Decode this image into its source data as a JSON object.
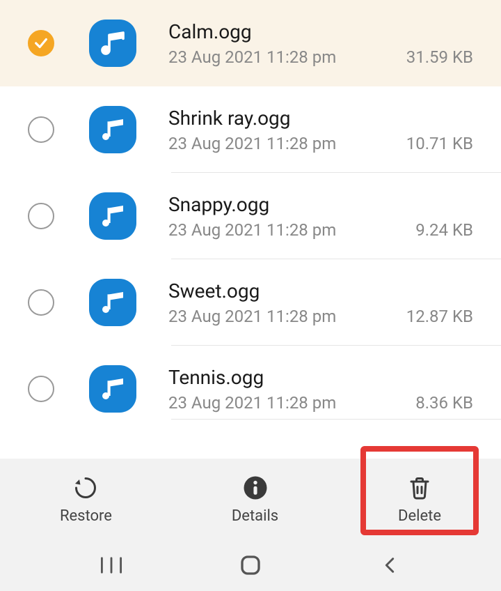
{
  "files": [
    {
      "name": "Calm.ogg",
      "date": "23 Aug 2021 11:28 pm",
      "size": "31.59 KB",
      "selected": true
    },
    {
      "name": "Shrink ray.ogg",
      "date": "23 Aug 2021 11:28 pm",
      "size": "10.71 KB",
      "selected": false
    },
    {
      "name": "Snappy.ogg",
      "date": "23 Aug 2021 11:28 pm",
      "size": "9.24 KB",
      "selected": false
    },
    {
      "name": "Sweet.ogg",
      "date": "23 Aug 2021 11:28 pm",
      "size": "12.87 KB",
      "selected": false
    },
    {
      "name": "Tennis.ogg",
      "date": "23 Aug 2021 11:28 pm",
      "size": "8.36 KB",
      "selected": false
    }
  ],
  "toolbar": {
    "restore_label": "Restore",
    "details_label": "Details",
    "delete_label": "Delete"
  },
  "colors": {
    "selected_bg": "#faf3e7",
    "checkbox_checked": "#f5a623",
    "music_icon_bg": "#1783d4",
    "highlight": "#e53935"
  }
}
